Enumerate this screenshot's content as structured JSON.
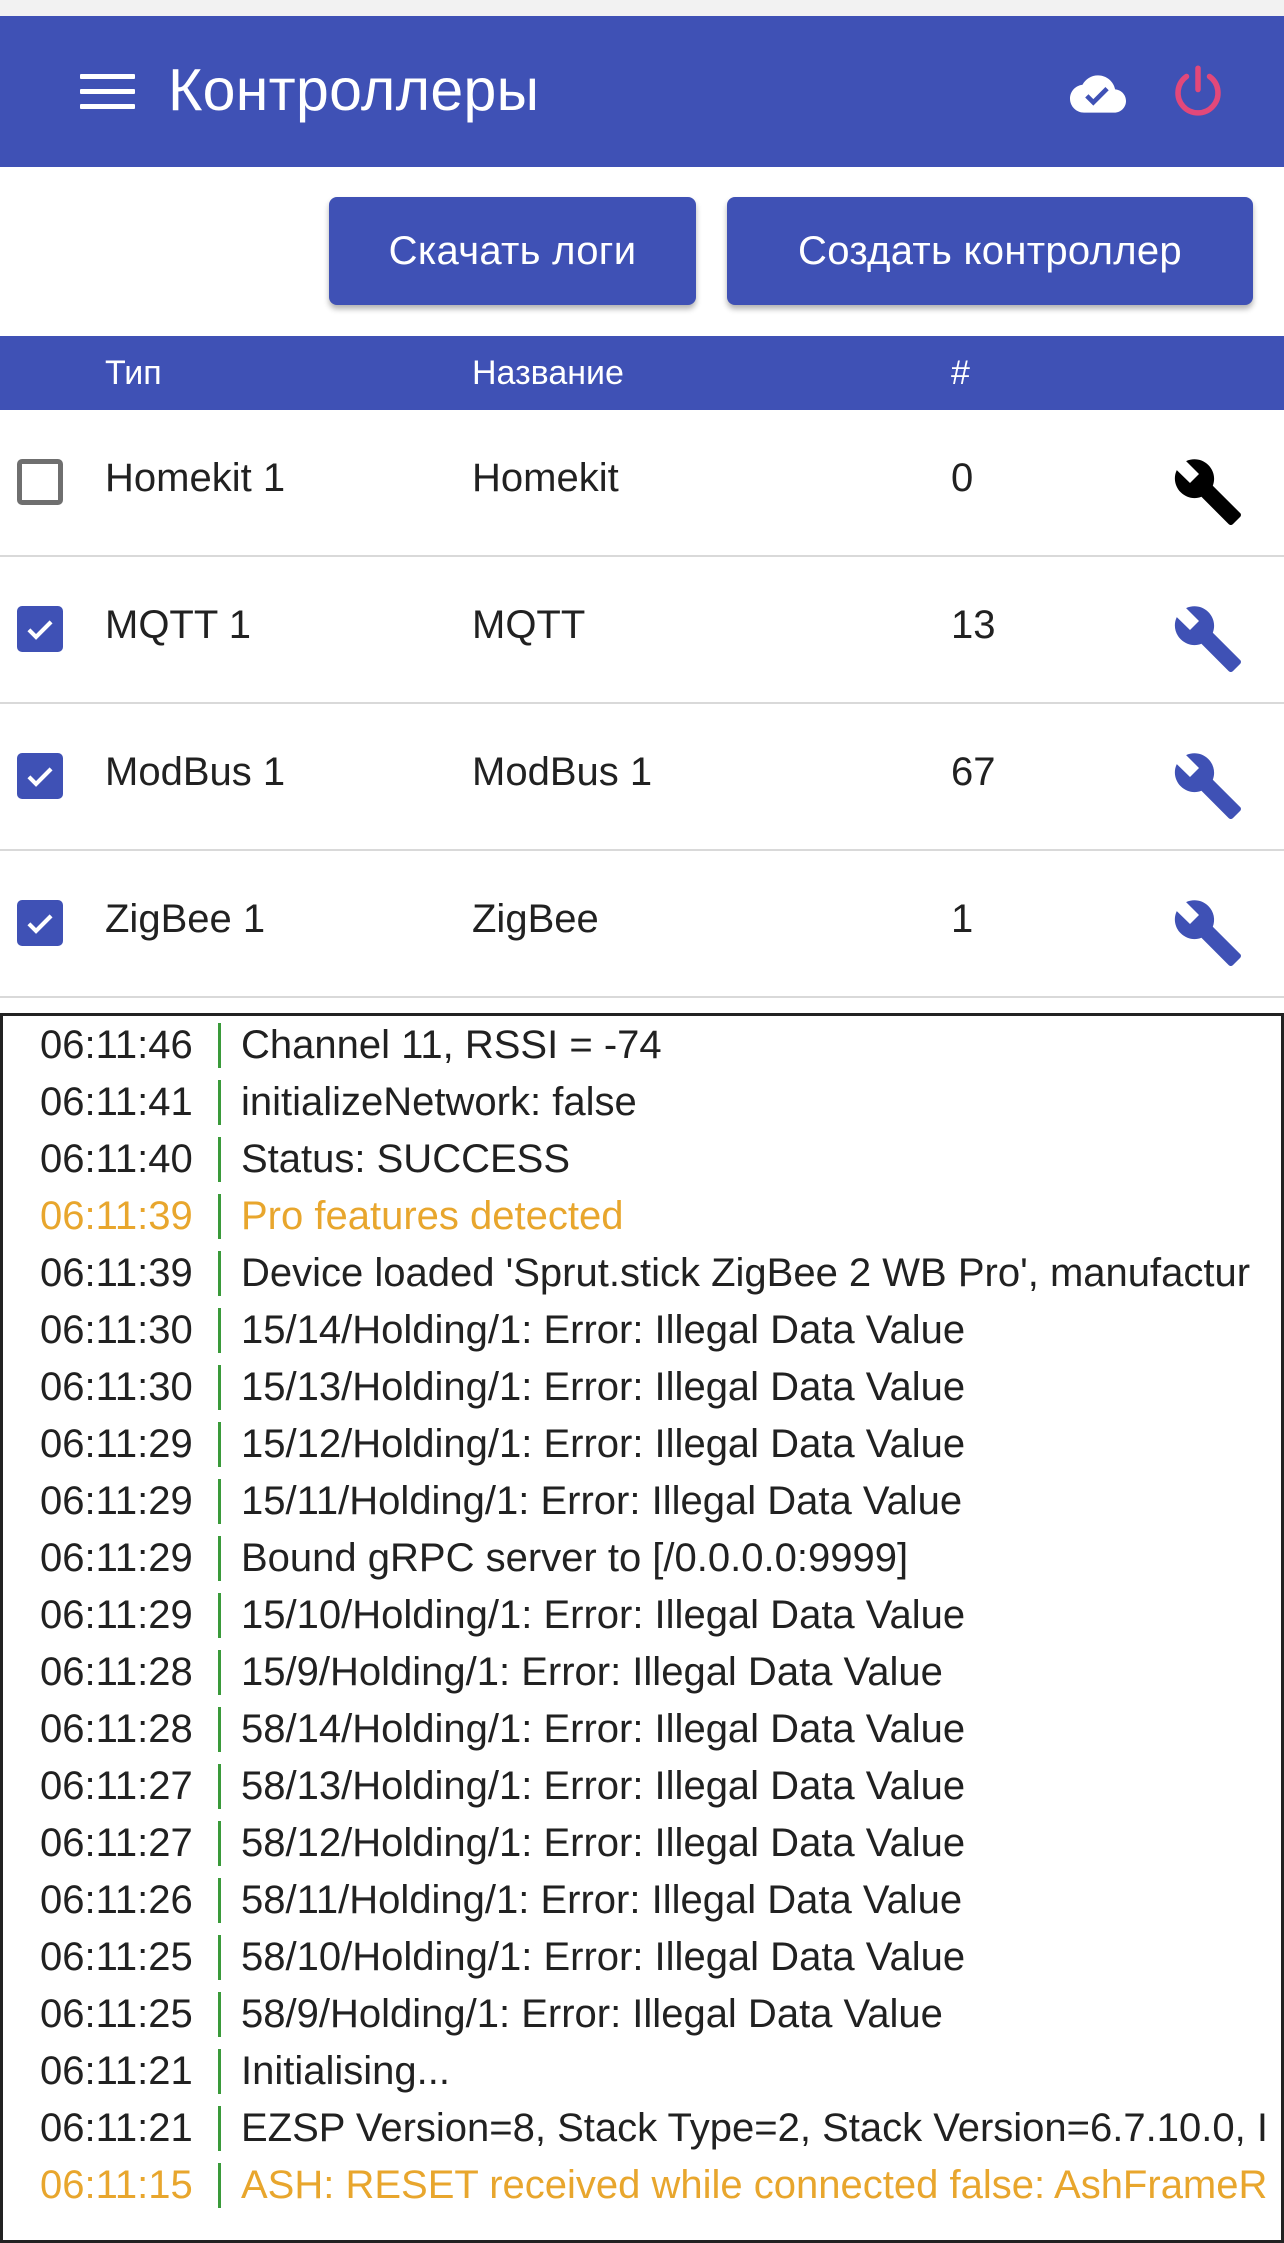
{
  "app": {
    "title": "Контроллеры",
    "accent_color": "#3f51b5",
    "power_color": "#e2487a",
    "icons": {
      "menu": "menu-icon",
      "cloud": "cloud-done-icon",
      "power": "power-icon"
    }
  },
  "actions": {
    "download_logs_label": "Скачать логи",
    "create_controller_label": "Создать контроллер"
  },
  "table": {
    "headers": {
      "type": "Тип",
      "name": "Название",
      "count": "#"
    },
    "rows": [
      {
        "type": "Homekit 1",
        "name": "Homekit",
        "count": "0",
        "checked": false,
        "wrench_color": "#000000"
      },
      {
        "type": "MQTT 1",
        "name": "MQTT",
        "count": "13",
        "checked": true,
        "wrench_color": "#3f51b5"
      },
      {
        "type": "ModBus 1",
        "name": "ModBus 1",
        "count": "67",
        "checked": true,
        "wrench_color": "#3f51b5"
      },
      {
        "type": "ZigBee 1",
        "name": "ZigBee",
        "count": "1",
        "checked": true,
        "wrench_color": "#3f51b5"
      }
    ]
  },
  "log": {
    "warn_color": "#e8a62d",
    "lines": [
      {
        "time": "06:11:46",
        "msg": "Channel 11, RSSI = -74",
        "level": "info"
      },
      {
        "time": "06:11:41",
        "msg": "initializeNetwork: false",
        "level": "info"
      },
      {
        "time": "06:11:40",
        "msg": "Status: SUCCESS",
        "level": "info"
      },
      {
        "time": "06:11:39",
        "msg": "Pro features detected",
        "level": "warn"
      },
      {
        "time": "06:11:39",
        "msg": "Device loaded 'Sprut.stick ZigBee 2 WB Pro', manufactur",
        "level": "info"
      },
      {
        "time": "06:11:30",
        "msg": "15/14/Holding/1: Error: Illegal Data Value",
        "level": "info"
      },
      {
        "time": "06:11:30",
        "msg": "15/13/Holding/1: Error: Illegal Data Value",
        "level": "info"
      },
      {
        "time": "06:11:29",
        "msg": "15/12/Holding/1: Error: Illegal Data Value",
        "level": "info"
      },
      {
        "time": "06:11:29",
        "msg": "15/11/Holding/1: Error: Illegal Data Value",
        "level": "info"
      },
      {
        "time": "06:11:29",
        "msg": "Bound gRPC server to [/0.0.0.0:9999]",
        "level": "info"
      },
      {
        "time": "06:11:29",
        "msg": "15/10/Holding/1: Error: Illegal Data Value",
        "level": "info"
      },
      {
        "time": "06:11:28",
        "msg": "15/9/Holding/1: Error: Illegal Data Value",
        "level": "info"
      },
      {
        "time": "06:11:28",
        "msg": "58/14/Holding/1: Error: Illegal Data Value",
        "level": "info"
      },
      {
        "time": "06:11:27",
        "msg": "58/13/Holding/1: Error: Illegal Data Value",
        "level": "info"
      },
      {
        "time": "06:11:27",
        "msg": "58/12/Holding/1: Error: Illegal Data Value",
        "level": "info"
      },
      {
        "time": "06:11:26",
        "msg": "58/11/Holding/1: Error: Illegal Data Value",
        "level": "info"
      },
      {
        "time": "06:11:25",
        "msg": "58/10/Holding/1: Error: Illegal Data Value",
        "level": "info"
      },
      {
        "time": "06:11:25",
        "msg": "58/9/Holding/1: Error: Illegal Data Value",
        "level": "info"
      },
      {
        "time": "06:11:21",
        "msg": "Initialising...",
        "level": "info"
      },
      {
        "time": "06:11:21",
        "msg": "EZSP Version=8, Stack Type=2, Stack Version=6.7.10.0, I",
        "level": "info"
      },
      {
        "time": "06:11:15",
        "msg": "ASH: RESET received while connected false: AshFrameR",
        "level": "warn"
      }
    ]
  }
}
